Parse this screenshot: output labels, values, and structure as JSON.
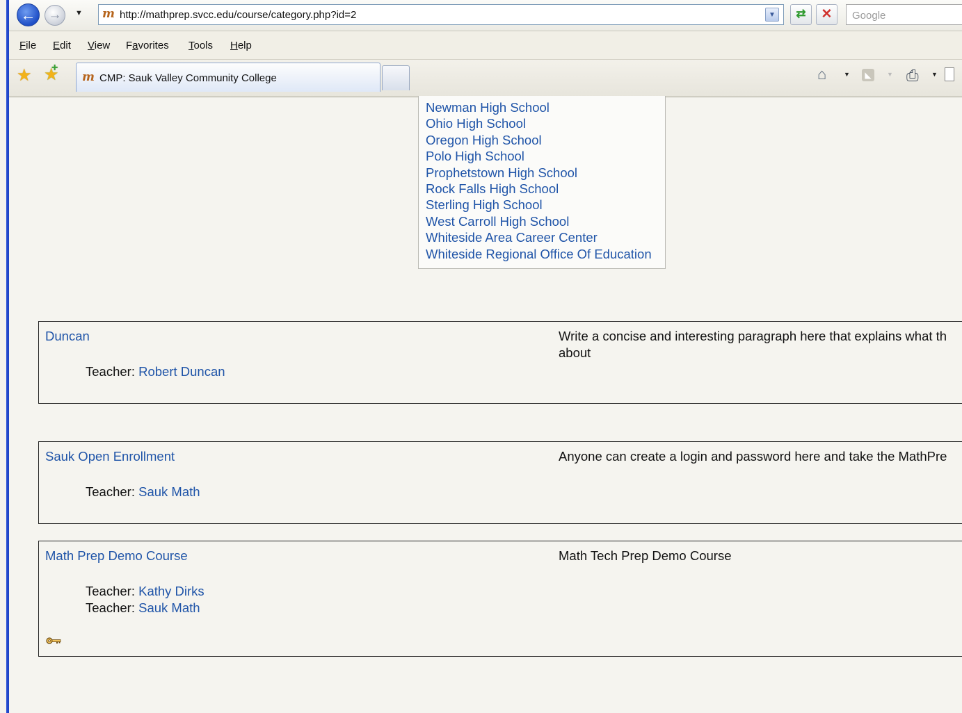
{
  "browser": {
    "url": "http://mathprep.svcc.edu/course/category.php?id=2",
    "search_placeholder": "Google",
    "menu": [
      "File",
      "Edit",
      "View",
      "Favorites",
      "Tools",
      "Help"
    ],
    "tab_title": "CMP: Sauk Valley Community College",
    "favicon_text": "m"
  },
  "schools": [
    "Newman High School",
    "Ohio High School",
    "Oregon High School",
    "Polo High School",
    "Prophetstown High School",
    "Rock Falls High School",
    "Sterling High School",
    "West Carroll High School",
    "Whiteside Area Career Center",
    "Whiteside Regional Office Of Education"
  ],
  "teacher_label": "Teacher: ",
  "courses": [
    {
      "name": "Duncan",
      "description": "Write a concise and interesting paragraph here that explains what th",
      "description_line2": "about",
      "teachers": [
        "Robert Duncan"
      ]
    },
    {
      "name": "Sauk Open Enrollment",
      "description": "Anyone can create a login and password here and take the MathPre",
      "teachers": [
        "Sauk Math"
      ]
    },
    {
      "name": "Math Prep Demo Course",
      "description": "Math Tech Prep Demo Course",
      "teachers": [
        "Kathy Dirks",
        "Sauk Math"
      ],
      "guest_key_icon": "key-icon"
    }
  ]
}
